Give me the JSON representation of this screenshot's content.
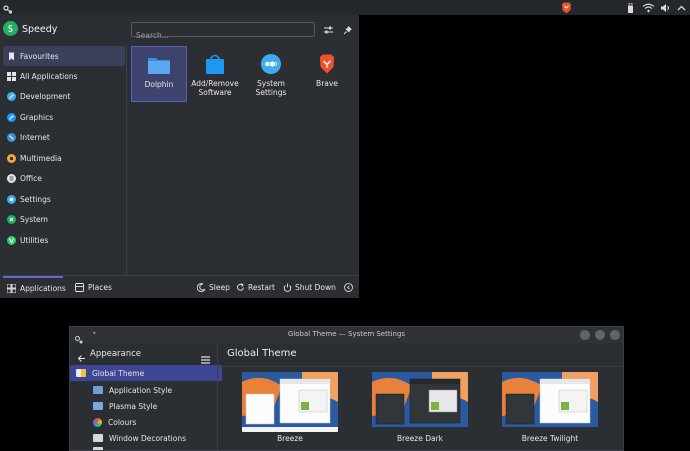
{
  "launcher": {
    "username": "Speedy",
    "search_placeholder": "Search...",
    "categories": [
      {
        "label": "Favourites",
        "icon": "bookmark-icon"
      },
      {
        "label": "All Applications",
        "icon": "grid-icon"
      },
      {
        "label": "Development",
        "icon": "development-icon"
      },
      {
        "label": "Graphics",
        "icon": "graphics-icon"
      },
      {
        "label": "Internet",
        "icon": "internet-icon"
      },
      {
        "label": "Multimedia",
        "icon": "multimedia-icon"
      },
      {
        "label": "Office",
        "icon": "office-icon"
      },
      {
        "label": "Settings",
        "icon": "settings-icon"
      },
      {
        "label": "System",
        "icon": "system-icon"
      },
      {
        "label": "Utilities",
        "icon": "utilities-icon"
      }
    ],
    "favourites": [
      {
        "label": "Dolphin",
        "icon": "folder-icon"
      },
      {
        "label": "Add/Remove Software",
        "icon": "discover-bag-icon"
      },
      {
        "label": "System Settings",
        "icon": "system-settings-icon"
      },
      {
        "label": "Brave",
        "icon": "brave-lion-icon"
      }
    ],
    "footer": {
      "tab_applications": "Applications",
      "tab_places": "Places",
      "sleep": "Sleep",
      "restart": "Restart",
      "shutdown": "Shut Down"
    }
  },
  "settings_window": {
    "title": "Global Theme — System Settings",
    "sidebar_title": "Appearance",
    "sidebar_items": [
      {
        "label": "Global Theme"
      },
      {
        "label": "Application Style"
      },
      {
        "label": "Plasma Style"
      },
      {
        "label": "Colours"
      },
      {
        "label": "Window Decorations"
      }
    ],
    "page_title": "Global Theme",
    "themes": [
      {
        "label": "Breeze"
      },
      {
        "label": "Breeze Dark"
      },
      {
        "label": "Breeze Twilight"
      }
    ]
  },
  "colors": {
    "accent": "#3d4694",
    "panel_bg": "#2b2e33",
    "topbar_bg": "#24272c"
  }
}
